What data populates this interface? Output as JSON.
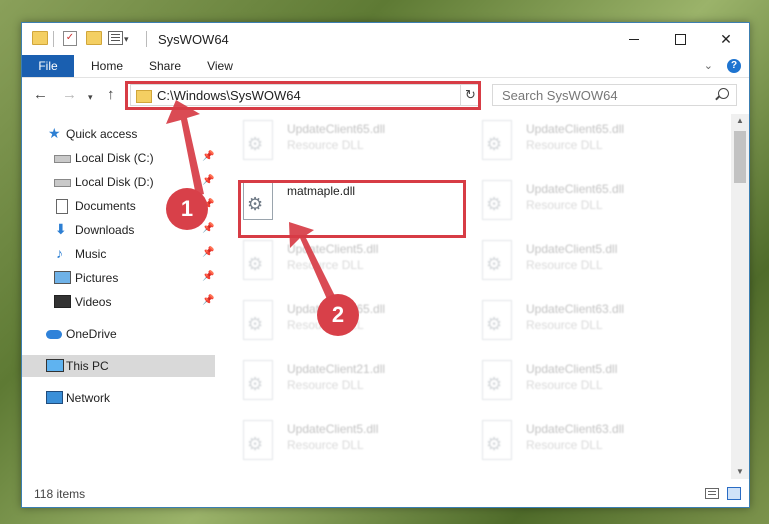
{
  "window": {
    "title": "SysWOW64",
    "controls": {
      "minimize": "—",
      "maximize": "☐",
      "close": "✕"
    }
  },
  "ribbon": {
    "tabs": [
      "File",
      "Home",
      "Share",
      "View"
    ],
    "help": "?"
  },
  "address": {
    "path": "C:\\Windows\\SysWOW64",
    "search_placeholder": "Search SysWOW64"
  },
  "sidebar": {
    "quick_access": "Quick access",
    "items": [
      {
        "label": "Local Disk (C:)",
        "icon": "drive-icon",
        "pinned": true
      },
      {
        "label": "Local Disk (D:)",
        "icon": "drive-icon",
        "pinned": true
      },
      {
        "label": "Documents",
        "icon": "documents-icon",
        "pinned": true
      },
      {
        "label": "Downloads",
        "icon": "downloads-icon",
        "pinned": true
      },
      {
        "label": "Music",
        "icon": "music-icon",
        "pinned": true
      },
      {
        "label": "Pictures",
        "icon": "pictures-icon",
        "pinned": true
      },
      {
        "label": "Videos",
        "icon": "videos-icon",
        "pinned": true
      }
    ],
    "onedrive": "OneDrive",
    "this_pc": "This PC",
    "network": "Network"
  },
  "files": {
    "left": [
      {
        "name": "UpdateClient65.dll",
        "type": "Resource DLL"
      },
      {
        "name": "matmaple.dll",
        "type": ""
      },
      {
        "name": "UpdateClient5.dll",
        "type": "Resource DLL"
      },
      {
        "name": "UpdateClient65.dll",
        "type": "Resource DLL"
      },
      {
        "name": "UpdateClient21.dll",
        "type": "Resource DLL"
      },
      {
        "name": "UpdateClient5.dll",
        "type": "Resource DLL"
      }
    ],
    "right": [
      {
        "name": "UpdateClient65.dll",
        "type": "Resource DLL"
      },
      {
        "name": "UpdateClient65.dll",
        "type": "Resource DLL"
      },
      {
        "name": "UpdateClient5.dll",
        "type": "Resource DLL"
      },
      {
        "name": "UpdateClient63.dll",
        "type": "Resource DLL"
      },
      {
        "name": "UpdateClient5.dll",
        "type": "Resource DLL"
      },
      {
        "name": "UpdateClient63.dll",
        "type": "Resource DLL"
      }
    ]
  },
  "status": {
    "item_count": "118 items"
  },
  "annotations": {
    "step1": "1",
    "step2": "2",
    "color": "#d73c45"
  }
}
